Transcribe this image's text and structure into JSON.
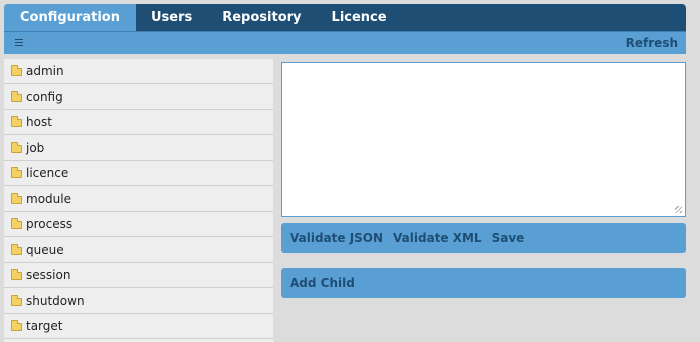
{
  "tabs": [
    {
      "label": "Configuration",
      "active": true
    },
    {
      "label": "Users"
    },
    {
      "label": "Repository"
    },
    {
      "label": "Licence"
    }
  ],
  "toolbar": {
    "menu_icon": "hamburger-icon",
    "refresh_label": "Refresh"
  },
  "tree": {
    "items": [
      {
        "label": "admin"
      },
      {
        "label": "config"
      },
      {
        "label": "host"
      },
      {
        "label": "job"
      },
      {
        "label": "licence"
      },
      {
        "label": "module"
      },
      {
        "label": "process"
      },
      {
        "label": "queue"
      },
      {
        "label": "session"
      },
      {
        "label": "shutdown"
      },
      {
        "label": "target"
      }
    ]
  },
  "editor": {
    "value": ""
  },
  "actions": {
    "validate_json": "Validate JSON",
    "validate_xml": "Validate XML",
    "save": "Save",
    "add_child": "Add Child"
  },
  "colors": {
    "header_dark": "#1f4e74",
    "accent": "#5a9fd4",
    "background": "#dcdcdc",
    "sidebar": "#eeeeee"
  }
}
